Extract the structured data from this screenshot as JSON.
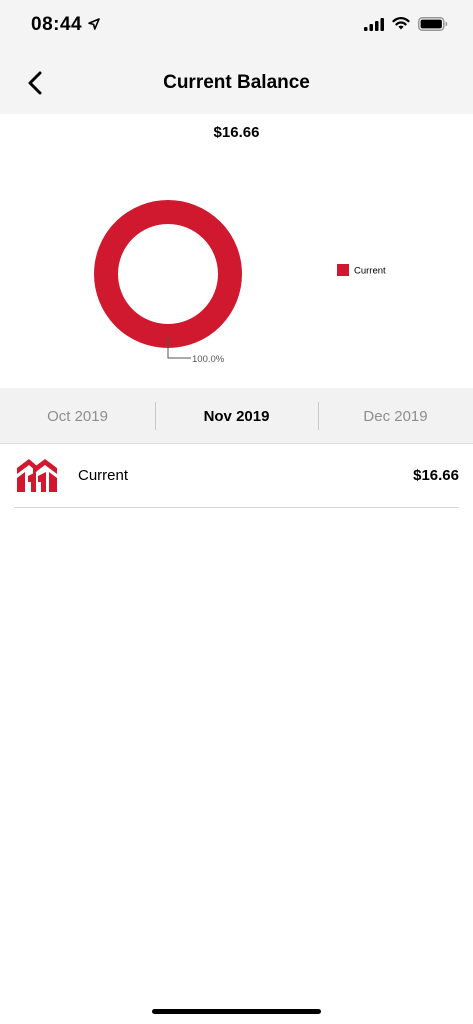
{
  "status_bar": {
    "time": "08:44",
    "icons": [
      "location-arrow-icon",
      "signal-icon",
      "wifi-icon",
      "battery-icon"
    ]
  },
  "nav": {
    "title": "Current Balance",
    "back_icon": "chevron-left-icon"
  },
  "chart": {
    "total": "$16.66",
    "slice_label": "100.0%",
    "legend_label": "Current"
  },
  "chart_data": {
    "type": "pie",
    "categories": [
      "Current"
    ],
    "values": [
      100.0
    ],
    "colors": [
      "#d0192e"
    ],
    "title": "$16.66",
    "legend_position": "right"
  },
  "months": {
    "prev": "Oct 2019",
    "current": "Nov 2019",
    "next": "Dec 2019"
  },
  "accounts": [
    {
      "name": "Current",
      "amount": "$16.66",
      "icon": "bank-logo-icon"
    }
  ],
  "colors": {
    "accent": "#d0192e",
    "header_bg": "#f4f4f4"
  }
}
